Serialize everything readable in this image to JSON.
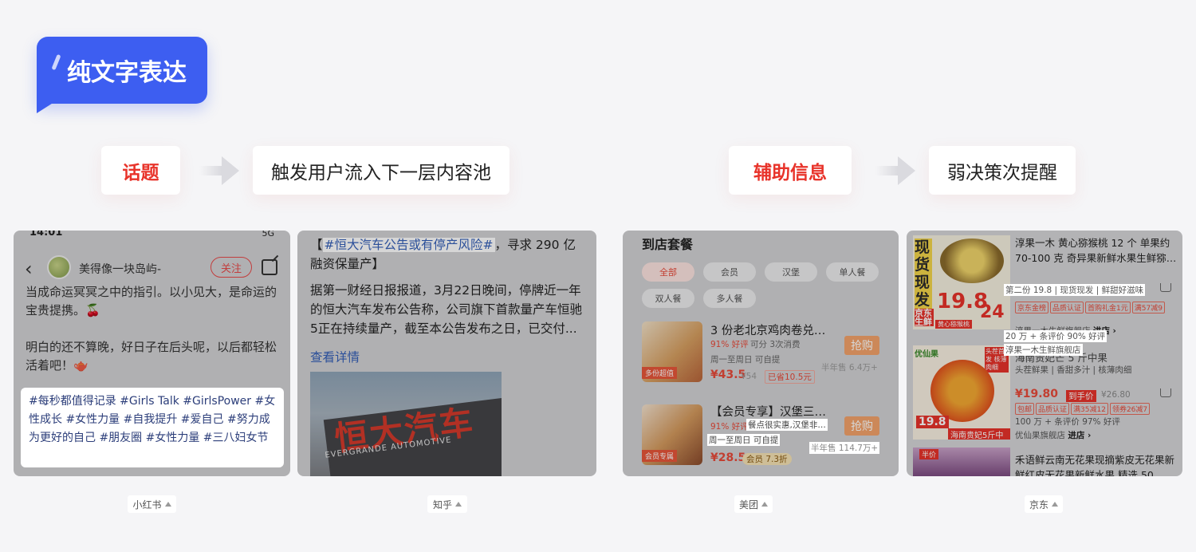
{
  "badge": "纯文字表达",
  "flows": [
    {
      "label": "话题",
      "desc": "触发用户流入下一层内容池"
    },
    {
      "label": "辅助信息",
      "desc": "弱决策次提醒"
    }
  ],
  "platforms": [
    "小红书",
    "知乎",
    "美团",
    "京东"
  ],
  "xhs": {
    "time": "14:01",
    "signal": "5G",
    "author": "美得像一块岛屿-",
    "follow": "关注",
    "line1": "当成命运冥冥之中的指引。以小见大，是命运的",
    "line2": "宝贵提携。🍒",
    "line3": "明白的还不算晚，好日子在后头呢，以后都轻松",
    "line4": "活着吧！🫖",
    "tags": "#每秒都值得记录 #Girls Talk  #GirlsPower  #女性成长  #女性力量  #自我提升  #爱自己  #努力成为更好的自己 #朋友圈  #女性力量  #三八妇女节"
  },
  "zhihu": {
    "bracket_open": "【",
    "topic": "#恒大汽车公告或有停产风险#",
    "title_rest": "，寻求 290 亿融资保量产】",
    "body": "据第一财经日报报道，3月22日晚间，停牌近一年的恒大汽车发布公告称，公司旗下首款量产车恒驰5正在持续量产，截至本公告发布之日，已交付...",
    "link": "查看详情",
    "sign": "恒大汽车",
    "sign_sub": "EVERGRANDE AUTOMOTIVE"
  },
  "meituan": {
    "section": "到店套餐",
    "chips": [
      "全部",
      "会员",
      "汉堡",
      "单人餐",
      "双人餐",
      "多人餐"
    ],
    "items": [
      {
        "name": "3 份老北京鸡肉卷兑…",
        "rate": "91% 好评",
        "info": "可分 3次消费",
        "time": "周一至周日  可自提",
        "price": "¥43.5",
        "orig": "¥54",
        "save": "已省10.5元",
        "sold": "半年售 6.4万+",
        "img_tag": "多份超值",
        "buy": "抢购"
      },
      {
        "name": "【会员专享】汉堡三…",
        "rate": "91% 好评",
        "info": "餐点很实惠,汉堡非…",
        "time": "周一至周日  可自提",
        "price": "¥28.5",
        "discount": "会员 7.3折",
        "sold": "半年售 114.7万+",
        "img_tag": "会员专属",
        "buy": "抢购"
      }
    ]
  },
  "jd": {
    "items": [
      {
        "title": "淳果一木 黄心猕猴桃 12 个 单果约 70-100 克 奇异果新鲜水果生鲜猕…",
        "sub": "第二份 19.8 | 现货现发 | 鲜甜好滋味",
        "tags": [
          "京东金榜",
          "品质认证",
          "首购礼金1元",
          "满57减9"
        ],
        "reviews": "20 万 + 条评价  90% 好评",
        "shop": "淳果一木生鲜旗舰店",
        "enter": "进店 ›",
        "img_big": "现货现发",
        "img_price": "19.8",
        "img_num": "24",
        "img_brand": "京东生鲜",
        "img_caption": "黄心猕猴桃"
      },
      {
        "title": "海南贵妃芒 5 斤中果",
        "sub": "头茬鲜果 | 香甜多汁 | 核薄肉细",
        "price": "¥19.80",
        "price_tag": "到手价",
        "orig": "¥26.80",
        "tags": [
          "包邮",
          "品质认证",
          "满35减12",
          "领券26减7"
        ],
        "reviews": "100 万 + 条评价  97% 好评",
        "shop": "优仙果旗舰店",
        "enter": "进店 ›",
        "img_label": "头茬首发 核薄肉细",
        "img_price": "19.8",
        "img_brand": "优仙果",
        "img_caption": "海南贵妃5斤中果"
      },
      {
        "title": "禾语鲜云南无花果现摘紫皮无花果新鲜红皮无花果新鲜水果 精选 50…",
        "img_tag": "半价"
      }
    ]
  },
  "overlays": {
    "jd_sub": "第二份 19.8 | 现货现发 | 鲜甜好滋味",
    "jd_reviews": "20 万 + 条评价  90% 好评",
    "jd_shop": "淳果一木生鲜旗舰店",
    "mt_time": "周一至周日  可自提",
    "mt_sold": "半年售 114.7万+"
  }
}
